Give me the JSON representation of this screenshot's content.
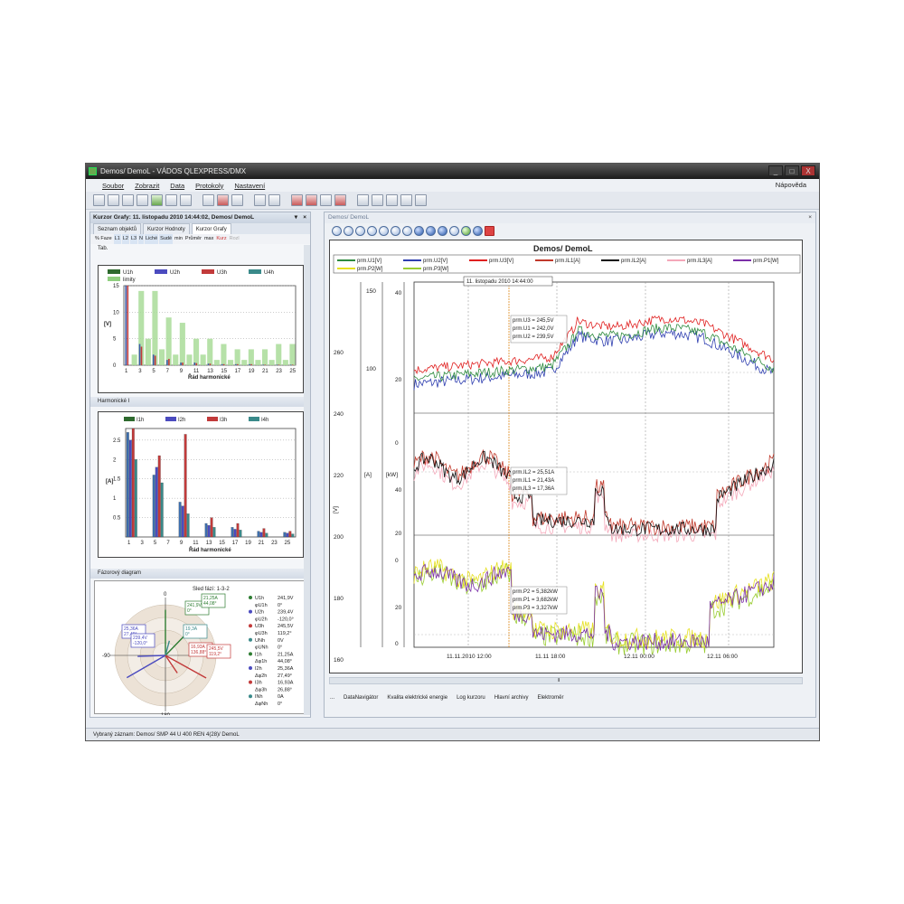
{
  "window": {
    "title": "Demos/ DemoL - VÁDOS QLEXPRESS/DMX",
    "buttons": [
      "_",
      "□",
      "X"
    ]
  },
  "menu": {
    "items": [
      "Soubor",
      "Zobrazit",
      "Data",
      "Protokoly",
      "Nastavení"
    ],
    "help": "Nápověda"
  },
  "left_panel": {
    "header": "Kurzor Grafy: 11. listopadu 2010 14:44:02, Demos/ DemoL",
    "tabs": [
      "Seznam objektů",
      "Kurzor Hodnoty",
      "Kurzor Grafy"
    ],
    "phase_buttons": [
      "% Faze",
      "L1",
      "L2",
      "L3",
      "N",
      "Liché",
      "Sudé",
      "min",
      "Průměr",
      "max",
      "Kurz",
      "Rozl"
    ],
    "tab_label": "Tab.",
    "section_harmonics_i": "Harmonické I",
    "section_phasor": "Fázorový diagram"
  },
  "harm_u_chart": {
    "legend": [
      "U1h",
      "U2h",
      "U3h",
      "U4h",
      "limity"
    ],
    "legend_colors": [
      "#2e6a2e",
      "#4b4bbf",
      "#c23a3a",
      "#3a8a8a",
      "#8fcf7f"
    ],
    "ylabel": "[V]",
    "xlabel": "Řád harmonické",
    "yticks": [
      "15",
      "10",
      "5",
      "0"
    ],
    "xticks": [
      "1",
      "3",
      "5",
      "7",
      "9",
      "11",
      "13",
      "15",
      "17",
      "19",
      "21",
      "23",
      "25"
    ],
    "limits": [
      0,
      2,
      14,
      5,
      14,
      3,
      9,
      2,
      8,
      2,
      5,
      2,
      5,
      1,
      4,
      1,
      3,
      1,
      3,
      1,
      3,
      1,
      4,
      1,
      4
    ],
    "u1": [
      15,
      0,
      4,
      0,
      2,
      0,
      1,
      0,
      0.5,
      0,
      0.5,
      0,
      0.3,
      0,
      0.2,
      0,
      0.2,
      0,
      0.2,
      0,
      0.1,
      0,
      0.1,
      0,
      0.1
    ],
    "u3": [
      15,
      0,
      3.5,
      0,
      1.8,
      0,
      1.2,
      0,
      0.5,
      0,
      0.4,
      0,
      0.3,
      0,
      0.2,
      0,
      0.2,
      0,
      0.2,
      0,
      0.1,
      0,
      0.1,
      0,
      0.1
    ]
  },
  "harm_i_chart": {
    "legend": [
      "I1h",
      "I2h",
      "I3h",
      "I4h"
    ],
    "legend_colors": [
      "#2e6a2e",
      "#4b4bbf",
      "#c23a3a",
      "#3a8a8a"
    ],
    "ylabel": "[A]",
    "xlabel": "Řád harmonické",
    "yticks": [
      "2.5",
      "2",
      "1.5",
      "1",
      "0.5"
    ],
    "xticks": [
      "1",
      "3",
      "5",
      "7",
      "9",
      "11",
      "13",
      "15",
      "17",
      "19",
      "21",
      "23",
      "25"
    ],
    "series": [
      {
        "name": "I1h",
        "color": "#3d6fae",
        "values": [
          2.7,
          0,
          1.6,
          0,
          0.9,
          0,
          0.35,
          0,
          0.25,
          0,
          0.15,
          0,
          0.12
        ]
      },
      {
        "name": "I2h",
        "color": "#4b4bbf",
        "values": [
          2.5,
          0,
          1.8,
          0,
          0.8,
          0,
          0.3,
          0,
          0.2,
          0,
          0.12,
          0,
          0.1
        ]
      },
      {
        "name": "I3h",
        "color": "#c23a3a",
        "values": [
          2.8,
          0,
          2.1,
          0,
          2.65,
          0,
          0.5,
          0,
          0.35,
          0,
          0.22,
          0,
          0.15
        ]
      },
      {
        "name": "I4h",
        "color": "#3a8a8a",
        "values": [
          2.0,
          0,
          1.4,
          0,
          0.6,
          0,
          0.25,
          0,
          0.18,
          0,
          0.1,
          0,
          0.08
        ]
      }
    ]
  },
  "phasor": {
    "title": "Sled fází: 1-3-2",
    "angle_labels": [
      "0",
      "90",
      "-90",
      "180"
    ],
    "boxes": [
      {
        "lines": [
          "241,9V",
          "0°"
        ],
        "color": "#2e7d32"
      },
      {
        "lines": [
          "21,25A",
          "44,08°"
        ],
        "color": "#2e7d32"
      },
      {
        "lines": [
          "25,36A",
          "27,49°"
        ],
        "color": "#4b4bbf"
      },
      {
        "lines": [
          "239,4V",
          "-120,0°"
        ],
        "color": "#4b4bbf"
      },
      {
        "lines": [
          "19,3A",
          "0°"
        ],
        "color": "#3a8a8a"
      },
      {
        "lines": [
          "16,93A",
          "136,88°"
        ],
        "color": "#c23a3a"
      },
      {
        "lines": [
          "245,5V",
          "119,2°"
        ],
        "color": "#c23a3a"
      }
    ],
    "rows": [
      {
        "label": "U1h",
        "value": "241,9V",
        "color": "#2e7d32"
      },
      {
        "label": "φU1h",
        "value": "0°",
        "color": ""
      },
      {
        "label": "U2h",
        "value": "239,4V",
        "color": "#4b4bbf"
      },
      {
        "label": "φU2h",
        "value": "-120,0°",
        "color": ""
      },
      {
        "label": "U3h",
        "value": "245,5V",
        "color": "#c23a3a"
      },
      {
        "label": "φU3h",
        "value": "119,2°",
        "color": ""
      },
      {
        "label": "UNh",
        "value": "0V",
        "color": "#3a8a8a"
      },
      {
        "label": "φUNh",
        "value": "0°",
        "color": ""
      },
      {
        "label": "I1h",
        "value": "21,25A",
        "color": "#2e7d32"
      },
      {
        "label": "Δφ1h",
        "value": "44,08°",
        "color": ""
      },
      {
        "label": "I2h",
        "value": "25,36A",
        "color": "#4b4bbf"
      },
      {
        "label": "Δφ2h",
        "value": "27,49°",
        "color": ""
      },
      {
        "label": "I3h",
        "value": "16,93A",
        "color": "#c23a3a"
      },
      {
        "label": "Δφ3h",
        "value": "26,88°",
        "color": ""
      },
      {
        "label": "INh",
        "value": "0A",
        "color": "#3a8a8a"
      },
      {
        "label": "ΔφNh",
        "value": "0°",
        "color": ""
      }
    ]
  },
  "right_panel": {
    "header": "Demos/ DemoL",
    "bottom_tabs": [
      "...",
      "DataNavigátor",
      "Kvalita elektrické energie",
      "Log kurzoru",
      "Hlavní archivy",
      "Elektroměr"
    ]
  },
  "main_chart": {
    "title": "Demos/ DemoL",
    "legend": [
      {
        "name": "prm.U1[V]",
        "color": "#2e8b3e"
      },
      {
        "name": "prm.U2[V]",
        "color": "#2f3fb0"
      },
      {
        "name": "prm.U3[V]",
        "color": "#e02020"
      },
      {
        "name": "prm.IL1[A]",
        "color": "#c0392b"
      },
      {
        "name": "prm.IL2[A]",
        "color": "#111111"
      },
      {
        "name": "prm.IL3[A]",
        "color": "#f4a7b9"
      },
      {
        "name": "prm.P1[W]",
        "color": "#7b2fa8"
      },
      {
        "name": "prm.P2[W]",
        "color": "#e6e020"
      },
      {
        "name": "prm.P3[W]",
        "color": "#9acd32"
      }
    ],
    "cursor_label": "11. listopadu 2010 14:44:00",
    "axis_v_ticks": [
      "260",
      "240",
      "220",
      "200",
      "180",
      "160"
    ],
    "axis_v_label": "[V]",
    "axis_a_ticks": [
      "150",
      "100"
    ],
    "axis_a_label": "[A]",
    "axis_kw_ticks": [
      "40",
      "20",
      "0",
      "40",
      "20",
      "0",
      "20",
      "0"
    ],
    "axis_kw_label": "[kW]",
    "xticks": [
      "11.11.2010 12:00",
      "11.11 18:00",
      "12.11 00:00",
      "12.11 06:00"
    ],
    "annotations": [
      [
        "prm.U3 = 245,5V",
        "prm.U1 = 242,0V",
        "prm.U2 = 239,5V"
      ],
      [
        "prm.IL2 = 25,51A",
        "prm.IL1 = 21,43A",
        "prm.IL3 = 17,36A"
      ],
      [
        "prm.P2 = 5,382kW",
        "prm.P1 = 3,682kW",
        "prm.P3 = 3,327kW"
      ]
    ]
  },
  "status": {
    "text": "Vybraný záznam: Demos/ SMP 44 U 400 REN 4(28)/ DemoL"
  }
}
